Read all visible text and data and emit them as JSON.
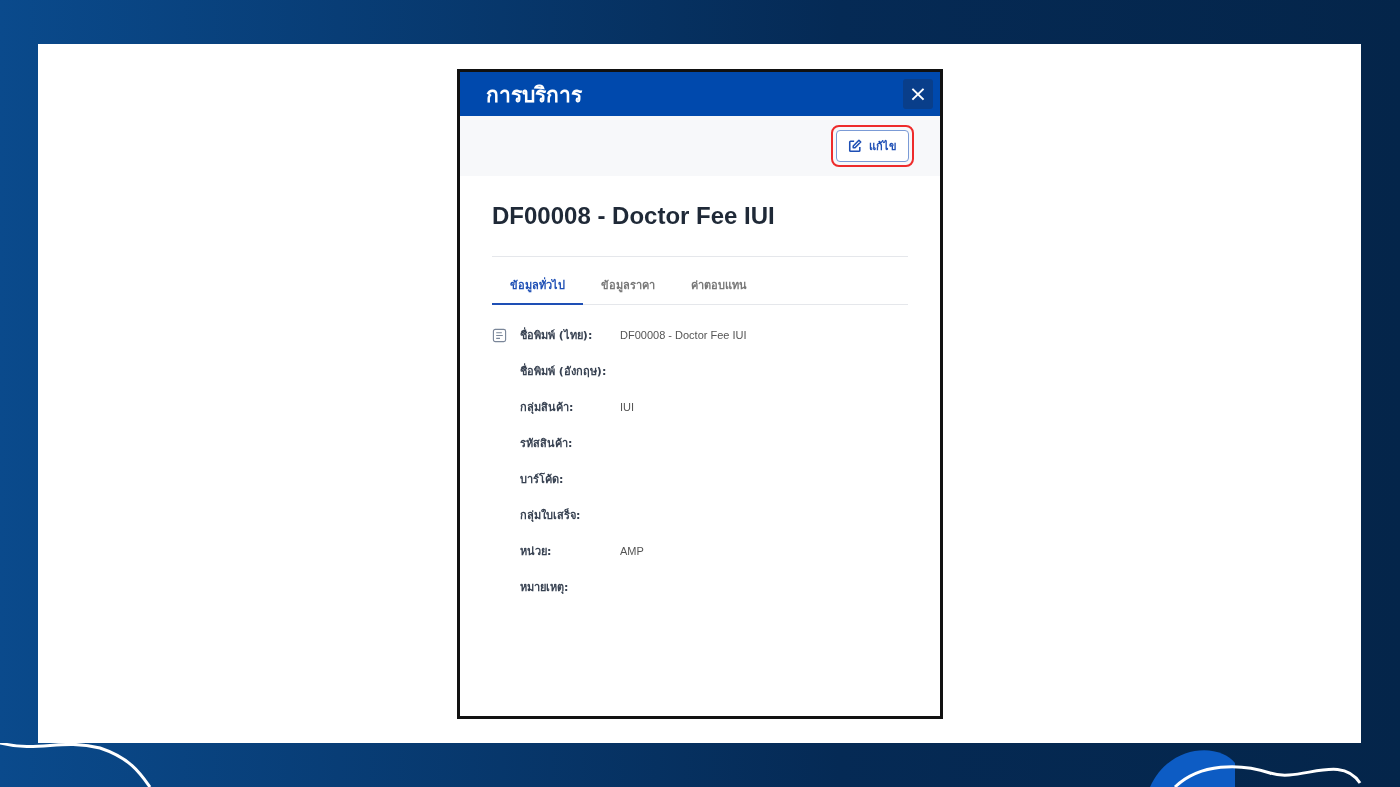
{
  "dialog": {
    "title": "การบริการ",
    "close_label": "×"
  },
  "toolbar": {
    "edit_button": {
      "label": "แก้ไข",
      "highlighted": true
    }
  },
  "heading": "DF00008 - Doctor Fee IUI",
  "tabs": [
    {
      "label": "ข้อมูลทั่วไป",
      "selected": true
    },
    {
      "label": "ข้อมูลราคา",
      "selected": false
    },
    {
      "label": "ค่าตอบแทน",
      "selected": false
    }
  ],
  "fields": [
    {
      "label": "ชื่อพิมพ์ (ไทย):",
      "value": "DF00008 - Doctor Fee IUI",
      "icon": true
    },
    {
      "label": "ชื่อพิมพ์ (อังกฤษ):",
      "icon": false
    },
    {
      "label": "กลุ่มสินค้า:",
      "value": "IUI",
      "icon": false
    },
    {
      "label": "รหัสสินค้า:",
      "icon": false
    },
    {
      "label": "บาร์โค้ด:",
      "icon": false
    },
    {
      "label": "กลุ่มใบเสร็จ:",
      "icon": false
    },
    {
      "label": "หน่วย:",
      "value": "AMP",
      "icon": false
    },
    {
      "label": "หมายเหตุ:",
      "icon": false
    }
  ]
}
